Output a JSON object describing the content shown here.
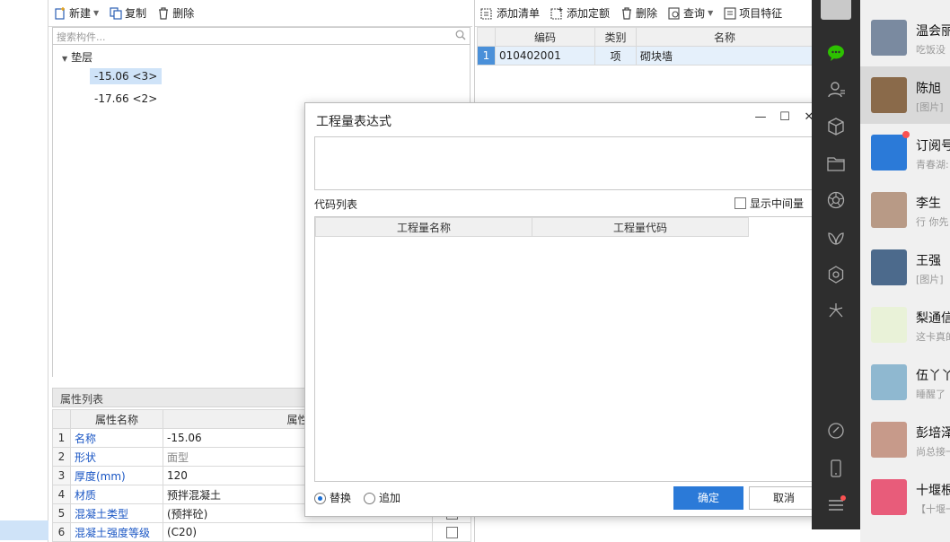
{
  "component_panel": {
    "toolbar": {
      "new": "新建",
      "copy": "复制",
      "delete": "删除"
    },
    "search_placeholder": "搜索构件...",
    "tree": {
      "root": "垫层",
      "items": [
        "-15.06 <3>",
        "-17.66 <2>"
      ]
    },
    "props_title": "属性列表",
    "props_headers": {
      "num": "",
      "name": "属性名称",
      "value": "属性",
      "extra": ""
    },
    "props_rows": [
      {
        "n": "1",
        "name": "名称",
        "value": "-15.06",
        "checkbox": false
      },
      {
        "n": "2",
        "name": "形状",
        "value": "面型",
        "checkbox": false
      },
      {
        "n": "3",
        "name": "厚度(mm)",
        "value": "120",
        "checkbox": false
      },
      {
        "n": "4",
        "name": "材质",
        "value": "预拌混凝土",
        "checkbox": false
      },
      {
        "n": "5",
        "name": "混凝土类型",
        "value": "(预拌砼)",
        "checkbox": true
      },
      {
        "n": "6",
        "name": "混凝土强度等级",
        "value": "(C20)",
        "checkbox": true
      }
    ]
  },
  "quantity_panel": {
    "toolbar": {
      "add_list": "添加清单",
      "add_quota": "添加定额",
      "delete": "删除",
      "query": "查询",
      "features": "项目特征"
    },
    "headers": {
      "num": "",
      "code": "编码",
      "type": "类别",
      "name": "名称"
    },
    "rows": [
      {
        "n": "1",
        "code": "010402001",
        "type": "项",
        "name": "砌块墙"
      }
    ]
  },
  "dialog": {
    "title": "工程量表达式",
    "code_list_label": "代码列表",
    "show_intermediate": "显示中间量",
    "col_name": "工程量名称",
    "col_code": "工程量代码",
    "radio_replace": "替换",
    "radio_append": "追加",
    "ok": "确定",
    "cancel": "取消"
  },
  "wechat": {
    "chats": [
      {
        "name": "温会丽",
        "preview": "吃饭没",
        "avatar": "#7a8aa0"
      },
      {
        "name": "陈旭",
        "preview": "[图片]",
        "avatar": "#8a6a4a"
      },
      {
        "name": "订阅号",
        "preview": "青春湖:",
        "avatar": "#2b7ad8"
      },
      {
        "name": "李生",
        "preview": "行 你先",
        "avatar": "#b89a86"
      },
      {
        "name": "王强",
        "preview": "[图片]",
        "avatar": "#4c6a8c"
      },
      {
        "name": "梨通信",
        "preview": "这卡真的",
        "avatar": "#e9f2d8"
      },
      {
        "name": "伍丫丫",
        "preview": "睡醒了",
        "avatar": "#8fb8d0"
      },
      {
        "name": "彭培泽",
        "preview": "尚总接一",
        "avatar": "#c79a8a"
      },
      {
        "name": "十堰根",
        "preview": "【十堰一",
        "avatar": "#e85c7a"
      }
    ]
  }
}
